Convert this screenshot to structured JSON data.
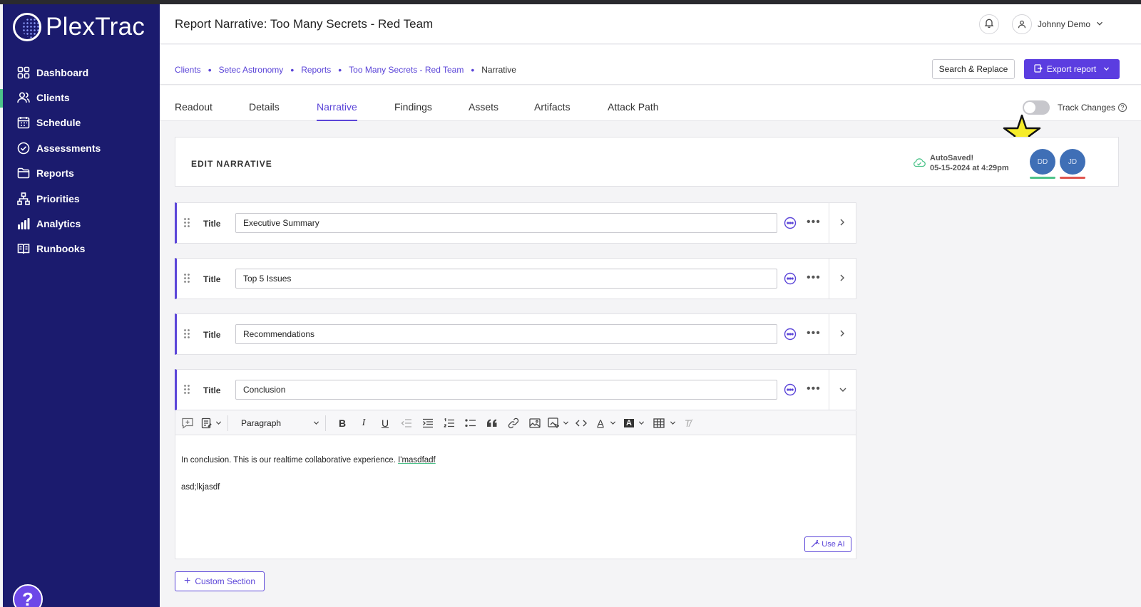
{
  "app": {
    "name": "PlexTrac"
  },
  "sidebar": {
    "items": [
      {
        "label": "Dashboard",
        "icon": "dashboard-icon"
      },
      {
        "label": "Clients",
        "icon": "clients-icon",
        "active": true
      },
      {
        "label": "Schedule",
        "icon": "calendar-icon"
      },
      {
        "label": "Assessments",
        "icon": "check-circle-icon"
      },
      {
        "label": "Reports",
        "icon": "folder-icon"
      },
      {
        "label": "Priorities",
        "icon": "hierarchy-icon"
      },
      {
        "label": "Analytics",
        "icon": "bar-chart-icon"
      },
      {
        "label": "Runbooks",
        "icon": "book-icon"
      }
    ],
    "help_label": "?"
  },
  "header": {
    "title": "Report Narrative: Too Many Secrets - Red Team",
    "user_name": "Johnny Demo"
  },
  "breadcrumb": {
    "items": [
      "Clients",
      "Setec Astronomy",
      "Reports",
      "Too Many Secrets - Red Team",
      "Narrative"
    ],
    "separator": "•"
  },
  "actions": {
    "search_replace": "Search & Replace",
    "export": "Export report"
  },
  "tabs": {
    "items": [
      "Readout",
      "Details",
      "Narrative",
      "Findings",
      "Assets",
      "Artifacts",
      "Attack Path"
    ],
    "active": "Narrative"
  },
  "track_changes": {
    "label": "Track Changes",
    "enabled": false,
    "help": "?"
  },
  "edit_panel": {
    "heading": "EDIT NARRATIVE",
    "autosave_status": "AutoSaved!",
    "autosave_time": "05-15-2024 at 4:29pm",
    "collaborators": [
      {
        "initials": "DD",
        "color": "#4cc38a"
      },
      {
        "initials": "JD",
        "color": "#e0554f"
      }
    ]
  },
  "sections": [
    {
      "label": "Title",
      "value": "Executive Summary",
      "expanded": false
    },
    {
      "label": "Title",
      "value": "Top 5 Issues",
      "expanded": false
    },
    {
      "label": "Title",
      "value": "Recommendations",
      "expanded": false
    },
    {
      "label": "Title",
      "value": "Conclusion",
      "expanded": true
    }
  ],
  "editor": {
    "block_format": "Paragraph",
    "line1_prefix": "In conclusion. This is our realtime collaborative experience.  ",
    "line1_highlight": "I'masdfadf",
    "line2": "asd;lkjasdf",
    "use_ai": "Use AI"
  },
  "footer": {
    "custom_section": "Custom Section"
  },
  "colors": {
    "sidebar": "#1b1b6e",
    "accent": "#5b45d8",
    "export_button": "#5b3de0",
    "active_indicator": "#4cc38a"
  }
}
